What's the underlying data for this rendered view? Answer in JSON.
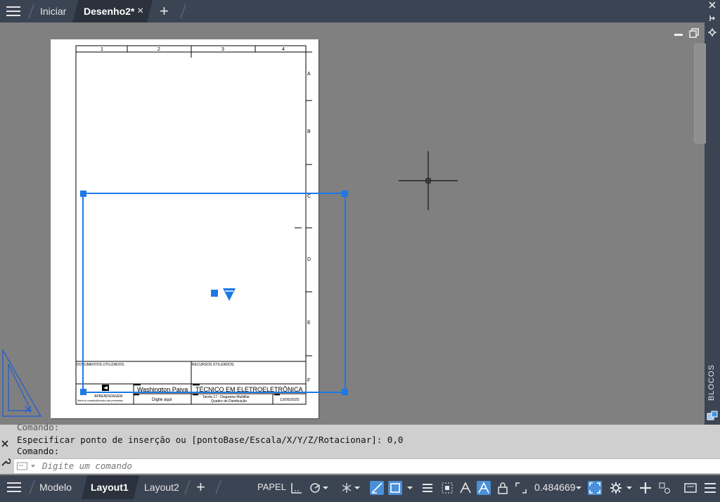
{
  "tabs": {
    "home": "Iniciar",
    "active": "Desenho2*",
    "close": "×",
    "add": "+"
  },
  "right_panel": {
    "label": "BLOCOS"
  },
  "drawing": {
    "col_labels": [
      "1",
      "2",
      "3",
      "4"
    ],
    "row_labels": [
      "A",
      "B",
      "C",
      "D",
      "E",
      "F"
    ],
    "title_block": {
      "docs_label": "DOCUMENTOS UTILIZADOS:",
      "resources_label": "RECURSOS UTILIZADOS:",
      "logo_caption": "APRENDIZAGEM",
      "logo_subcaption": "Moreno contato@ensino.sfs.presentes",
      "author": "Washington Paiva",
      "author_sub": "Digite aqui",
      "course": "TÉCNICO EM ELETROELETRÔNICA",
      "task_line1": "Tarefa 17 - Diagrama Multifilar",
      "task_line2": "Quadro de Distribuição",
      "date": "13/05/2025"
    }
  },
  "command": {
    "history0": "Comando:",
    "history1": "Especificar ponto de inserção ou [pontoBase/Escala/X/Y/Z/Rotacionar]: 0,0",
    "history2": "Comando:",
    "placeholder": "Digite um comando"
  },
  "status": {
    "tab_model": "Modelo",
    "tab_layout1": "Layout1",
    "tab_layout2": "Layout2",
    "add": "+",
    "paper": "PAPEL",
    "zoom": "0.484669"
  },
  "colors": {
    "topbar": "#3b4453",
    "viewport": "#808080",
    "selection": "#1e78e6",
    "cmd_bg": "#cfcfcf"
  }
}
